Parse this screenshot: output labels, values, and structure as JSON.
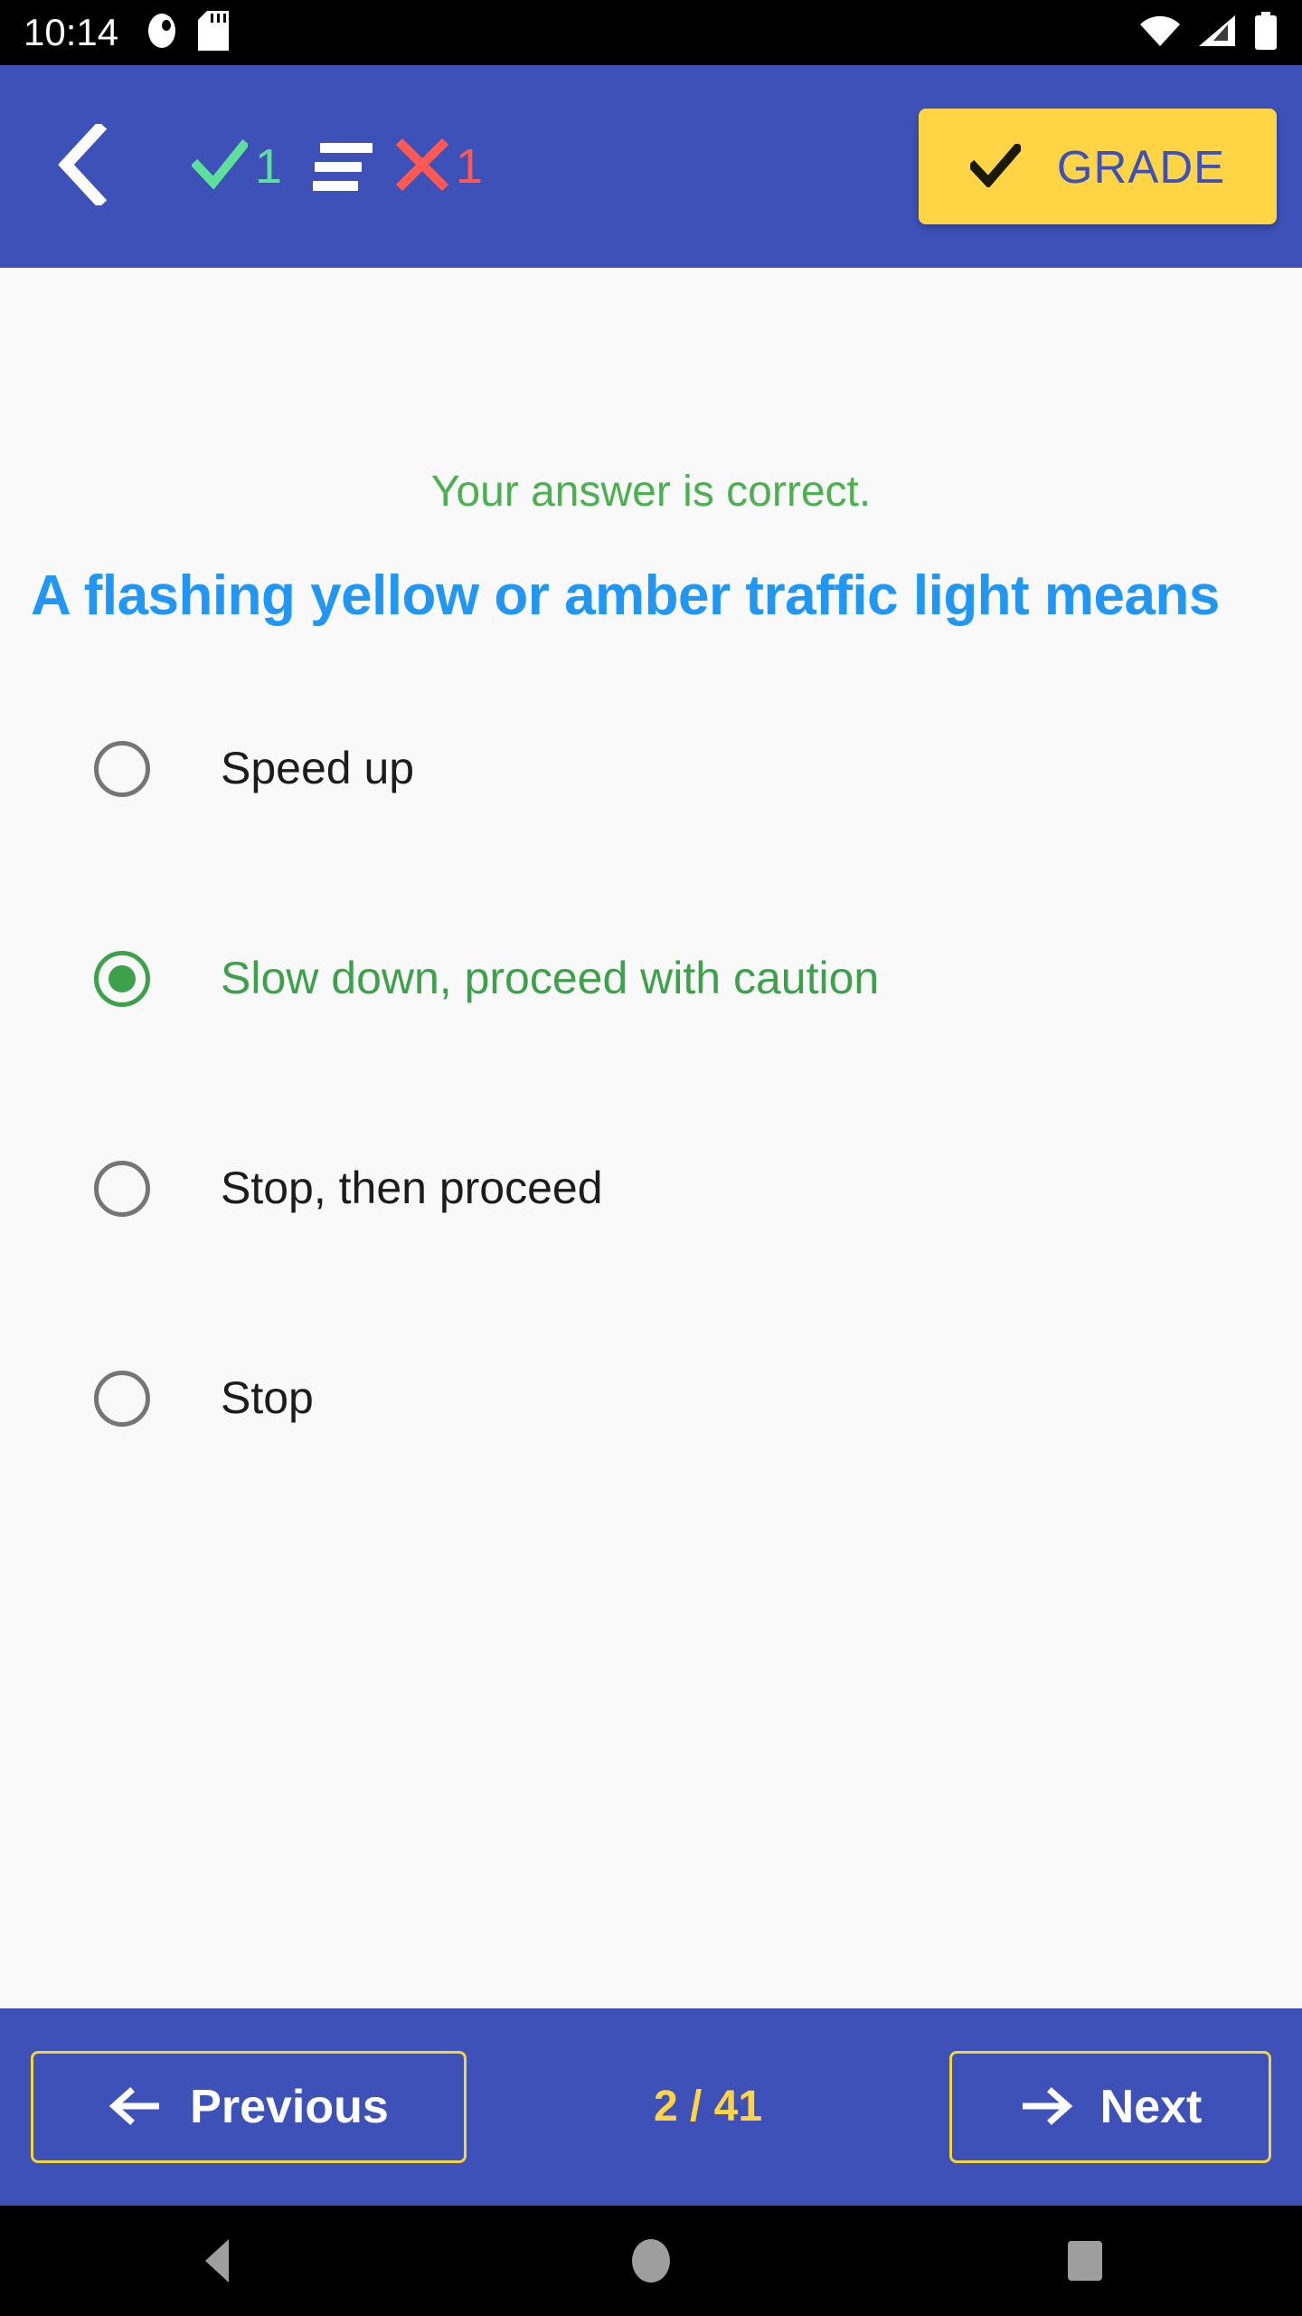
{
  "status_bar": {
    "time": "10:14",
    "left_icons": [
      "do-not-disturb-icon",
      "sd-card-icon"
    ],
    "right_icons": [
      "wifi-icon",
      "cellular-signal-icon",
      "battery-full-icon"
    ]
  },
  "app_bar": {
    "back_icon": "chevron-left-icon",
    "correct_icon": "check-icon",
    "correct_count": "1",
    "list_icon": "list-lines-icon",
    "wrong_icon": "x-mark-icon",
    "wrong_count": "1",
    "grade_button": {
      "icon": "check-icon",
      "label": "GRADE"
    },
    "colors": {
      "background": "#3D51B8",
      "correct_green": "#5FE09A",
      "wrong_red": "#FF5A52",
      "grade_bg": "#FFD545",
      "grade_text": "#3D51B8"
    }
  },
  "main": {
    "feedback": "Your answer is correct.",
    "question": "A flashing yellow or amber traffic light means",
    "options": [
      {
        "label": "Speed up",
        "selected": false,
        "correct": false
      },
      {
        "label": "Slow down, proceed with caution",
        "selected": true,
        "correct": true
      },
      {
        "label": "Stop, then proceed",
        "selected": false,
        "correct": false
      },
      {
        "label": "Stop",
        "selected": false,
        "correct": false
      }
    ],
    "colors": {
      "background": "#F9F9F9",
      "feedback_green": "#4CAF50",
      "question_blue": "#2196F3",
      "correct_green": "#3CA14A",
      "radio_gray": "#757575"
    }
  },
  "bottom_bar": {
    "previous": {
      "icon": "arrow-left-icon",
      "label": "Previous"
    },
    "page_indicator": "2 / 41",
    "next": {
      "icon": "arrow-right-icon",
      "label": "Next"
    },
    "colors": {
      "background": "#3D51B8",
      "border_yellow": "#F2D43B",
      "indicator_yellow": "#FFD545"
    }
  },
  "android_nav": {
    "back": "android-back-icon",
    "home": "android-home-icon",
    "recents": "android-recents-icon"
  }
}
